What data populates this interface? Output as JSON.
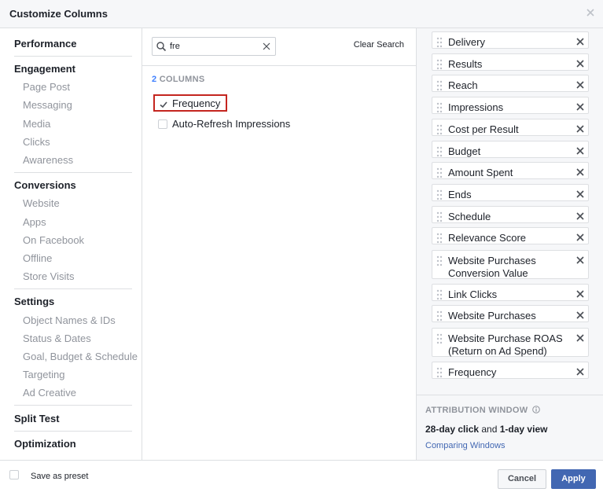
{
  "dialog": {
    "title": "Customize Columns"
  },
  "nav": {
    "performance": "Performance",
    "engagement": "Engagement",
    "engagement_items": [
      "Page Post",
      "Messaging",
      "Media",
      "Clicks",
      "Awareness"
    ],
    "conversions": "Conversions",
    "conversions_items": [
      "Website",
      "Apps",
      "On Facebook",
      "Offline",
      "Store Visits"
    ],
    "settings": "Settings",
    "settings_items": [
      "Object Names & IDs",
      "Status & Dates",
      "Goal, Budget & Schedule",
      "Targeting",
      "Ad Creative"
    ],
    "split_test": "Split Test",
    "optimization": "Optimization"
  },
  "search": {
    "value": "fre",
    "clear_label": "Clear Search"
  },
  "results": {
    "count": "2",
    "count_suffix": "COLUMNS",
    "options": [
      {
        "label": "Frequency",
        "checked": true
      },
      {
        "label": "Auto-Refresh Impressions",
        "checked": false
      }
    ]
  },
  "selected_columns": [
    "Delivery",
    "Results",
    "Reach",
    "Impressions",
    "Cost per Result",
    "Budget",
    "Amount Spent",
    "Ends",
    "Schedule",
    "Relevance Score",
    "Website Purchases Conversion Value",
    "Link Clicks",
    "Website Purchases",
    "Website Purchase ROAS (Return on Ad Spend)",
    "Frequency"
  ],
  "selected_columns_lines": {
    "wpcv_1": "Website Purchases",
    "wpcv_2": "Conversion Value",
    "roas_1": "Website Purchase ROAS",
    "roas_2": "(Return on Ad Spend)"
  },
  "attribution": {
    "heading": "ATTRIBUTION WINDOW",
    "click": "28-day click",
    "and": " and ",
    "view": "1-day view",
    "link": "Comparing Windows"
  },
  "footer": {
    "preset_label": "Save as preset",
    "cancel": "Cancel",
    "apply": "Apply"
  },
  "colors": {
    "accent": "#4267b2",
    "highlight": "#c4251f",
    "count": "#4080ff"
  }
}
